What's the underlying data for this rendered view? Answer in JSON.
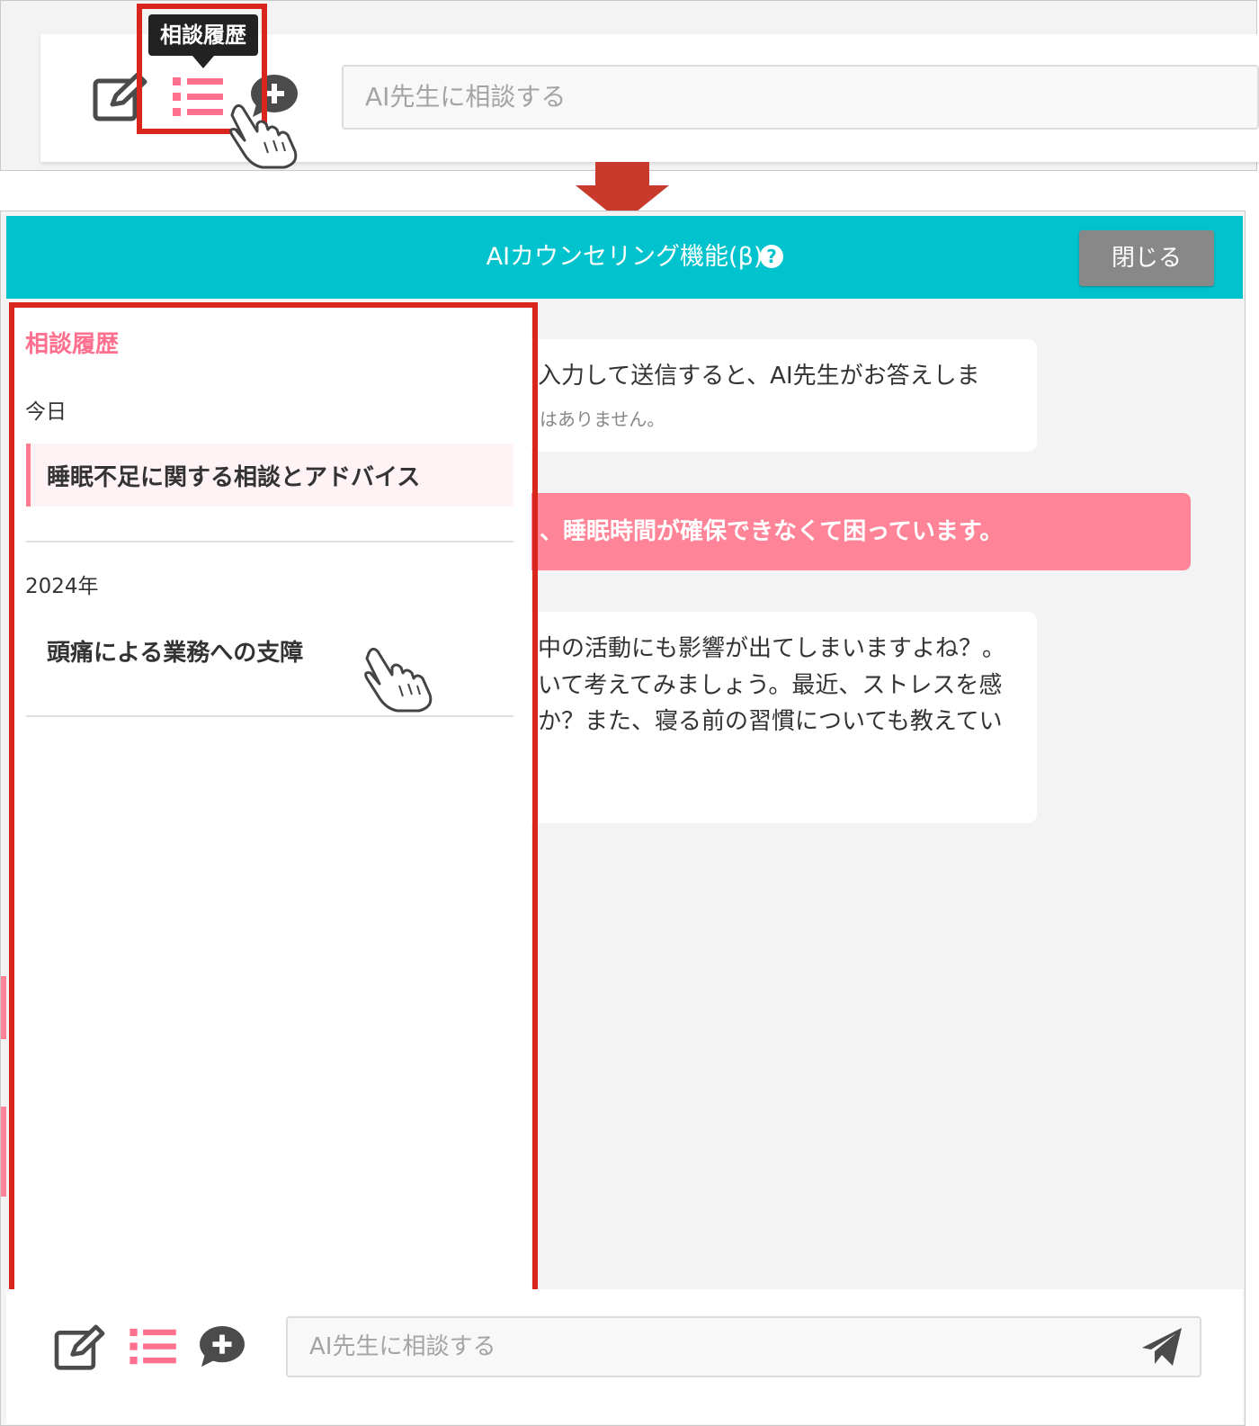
{
  "top_panel": {
    "tooltip": "相談履歴",
    "input_placeholder": "AI先生に相談する",
    "icons": [
      "new-chat-icon",
      "history-list-icon",
      "chat-add-icon",
      "pointer-hand-icon"
    ]
  },
  "dialog": {
    "title": "AIカウンセリング機能(β)",
    "help_icon": "?",
    "close_label": "閉じる"
  },
  "chat": {
    "ai_message_1_line1": "入力して送信すると、AI先生がお答えしま",
    "ai_message_1_note": "はありません。",
    "user_message": "、睡眠時間が確保できなくて困っています。",
    "ai_message_2_lines": [
      "中の活動にも影響が出てしまいますよね？。",
      "いて考えてみましょう。最近、ストレスを感",
      "か？また、寝る前の習慣についても教えてい"
    ]
  },
  "history_drawer": {
    "title": "相談履歴",
    "groups": [
      {
        "label": "今日",
        "items": [
          "睡眠不足に関する相談とアドバイス"
        ]
      },
      {
        "label": "2024年",
        "items": [
          "頭痛による業務への支障"
        ]
      }
    ]
  },
  "footer": {
    "input_placeholder": "AI先生に相談する",
    "icons": [
      "new-chat-icon",
      "history-list-icon",
      "chat-add-icon",
      "send-icon"
    ]
  },
  "colors": {
    "header": "#00c3cd",
    "accent_pink": "#ff6f8e",
    "user_bubble": "#ff8497",
    "highlight_red": "#d9251c",
    "arrow": "#c9392c"
  }
}
